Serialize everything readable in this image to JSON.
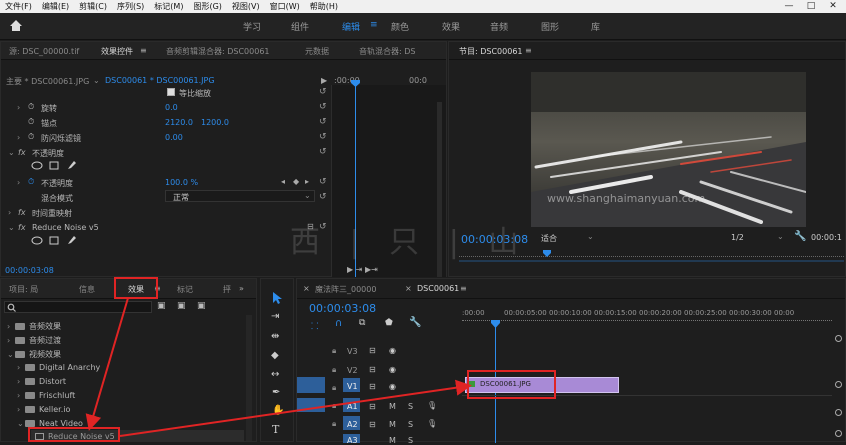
{
  "menu": [
    "文件(F)",
    "编辑(E)",
    "剪辑(C)",
    "序列(S)",
    "标记(M)",
    "图形(G)",
    "视图(V)",
    "窗口(W)",
    "帮助(H)"
  ],
  "window_controls": [
    "—",
    "□",
    "✕"
  ],
  "workspaces": [
    "学习",
    "组件",
    "编辑",
    "颜色",
    "效果",
    "音频",
    "图形",
    "库"
  ],
  "workspace_menu_glyph": "≡",
  "source_tabs": {
    "source": "源: DSC_00000.tif",
    "effect_controls": "效果控件",
    "audio_mixer": "音频剪辑混合器: DSC00061",
    "metadata": "元数据",
    "track_mixer": "音轨混合器: DS"
  },
  "effect_controls": {
    "master": "主要 * DSC00061.JPG",
    "clip": "DSC00061 * DSC00061.JPG",
    "time_left": ":00:00",
    "time_right": "00:0",
    "props": {
      "uniform_scale": "等比缩放",
      "rotation": "旋转",
      "rotation_val": "0.0",
      "anchor": "锚点",
      "anchor_x": "2120.0",
      "anchor_y": "1200.0",
      "flicker": "防闪烁滤镜",
      "flicker_val": "0.00",
      "opacity_group": "不透明度",
      "opacity": "不透明度",
      "opacity_val": "100.0 %",
      "blend": "混合模式",
      "blend_val": "正常",
      "time_remap": "时间重映射",
      "plugin": "Reduce Noise v5",
      "fx": "fx"
    },
    "timecode": "00:00:03:08"
  },
  "program": {
    "title": "节目: DSC00061",
    "timecode": "00:00:03:08",
    "fit": "适合",
    "quality": "1/2",
    "end_time": "00:00:1"
  },
  "watermark": {
    "text": "www.shanghaimanyuan.com",
    "logo": "西 | 只 | 山"
  },
  "project_tabs": {
    "project": "项目: 局",
    "info": "信息",
    "effects": "效果",
    "markers": "标记",
    "more": "抨"
  },
  "effects_tree": [
    {
      "label": "音频效果",
      "level": 0,
      "open": false
    },
    {
      "label": "音频过渡",
      "level": 0,
      "open": false
    },
    {
      "label": "视频效果",
      "level": 0,
      "open": true
    },
    {
      "label": "Digital Anarchy",
      "level": 1,
      "open": false
    },
    {
      "label": "Distort",
      "level": 1,
      "open": false
    },
    {
      "label": "Frischluft",
      "level": 1,
      "open": false
    },
    {
      "label": "Keller.io",
      "level": 1,
      "open": false
    },
    {
      "label": "Neat Video",
      "level": 1,
      "open": true
    },
    {
      "label": "Reduce Noise v5",
      "level": 2,
      "open": false
    }
  ],
  "timeline": {
    "tab_inactive": "魔法阵三_00000",
    "tab_active": "DSC00061",
    "timecode": "00:00:03:08",
    "ticks": [
      ":00:00",
      "00:00:05:00",
      "00:00:10:00",
      "00:00:15:00",
      "00:00:20:00",
      "00:00:25:00",
      "00:00:30:00",
      "00:00"
    ],
    "tracks": [
      "V3",
      "V2",
      "V1",
      "A1",
      "A2",
      "A3"
    ],
    "clip_label": "DSC00061.JPG",
    "m": "M",
    "s": "S"
  },
  "colors": {
    "accent": "#2d8ceb",
    "clip": "#a88ad6",
    "annotation": "#e02424"
  }
}
